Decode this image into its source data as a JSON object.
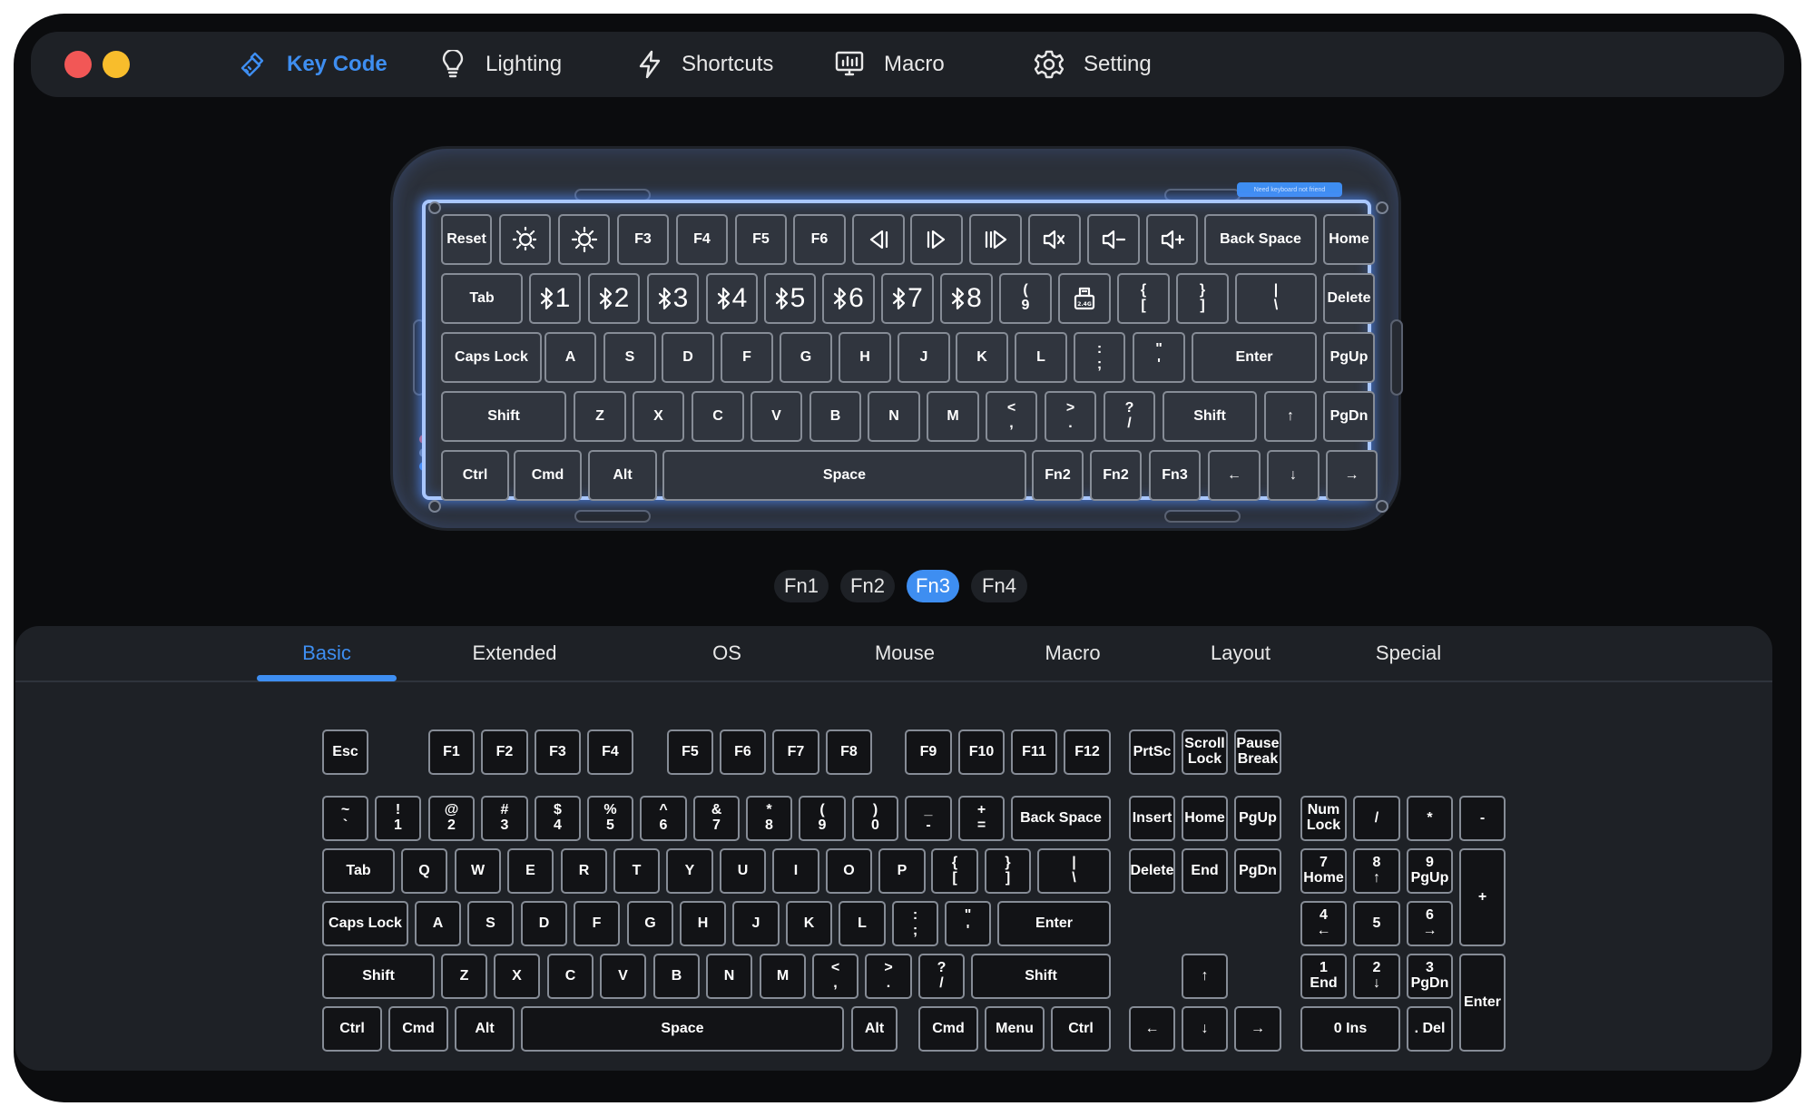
{
  "window": {
    "controls": [
      "close",
      "minimize"
    ]
  },
  "nav": [
    {
      "label": "Key Code",
      "icon": "pen-ruler-icon",
      "active": true
    },
    {
      "label": "Lighting",
      "icon": "lightbulb-icon",
      "active": false
    },
    {
      "label": "Shortcuts",
      "icon": "lightning-icon",
      "active": false
    },
    {
      "label": "Macro",
      "icon": "monitor-icon",
      "active": false
    },
    {
      "label": "Setting",
      "icon": "gear-icon",
      "active": false
    }
  ],
  "device": {
    "badge": "Need keyboard not friend",
    "rows": [
      [
        {
          "label": "Reset"
        },
        {
          "icon": "brightness-down"
        },
        {
          "icon": "brightness-up"
        },
        {
          "label": "F3"
        },
        {
          "label": "F4"
        },
        {
          "label": "F5"
        },
        {
          "label": "F6"
        },
        {
          "icon": "media-prev"
        },
        {
          "icon": "media-next"
        },
        {
          "icon": "media-play"
        },
        {
          "icon": "volume-mute"
        },
        {
          "icon": "volume-down"
        },
        {
          "icon": "volume-up"
        },
        {
          "label": "Back Space"
        },
        {
          "label": "Home"
        }
      ],
      [
        {
          "label": "Tab"
        },
        {
          "bt": "1"
        },
        {
          "bt": "2"
        },
        {
          "bt": "3"
        },
        {
          "bt": "4"
        },
        {
          "bt": "5"
        },
        {
          "bt": "6"
        },
        {
          "bt": "7"
        },
        {
          "bt": "8"
        },
        {
          "top": "(",
          "bottom": "9"
        },
        {
          "icon": "dongle-2.4g"
        },
        {
          "top": "{",
          "bottom": "["
        },
        {
          "top": "}",
          "bottom": "]"
        },
        {
          "top": "|",
          "bottom": "\\"
        },
        {
          "label": "Delete"
        }
      ],
      [
        {
          "label": "Caps Lock"
        },
        {
          "label": "A"
        },
        {
          "label": "S"
        },
        {
          "label": "D"
        },
        {
          "label": "F"
        },
        {
          "label": "G"
        },
        {
          "label": "H"
        },
        {
          "label": "J"
        },
        {
          "label": "K"
        },
        {
          "label": "L"
        },
        {
          "top": ":",
          "bottom": ";"
        },
        {
          "top": "\"",
          "bottom": "'"
        },
        {
          "label": "Enter"
        },
        {
          "label": "PgUp"
        }
      ],
      [
        {
          "label": "Shift"
        },
        {
          "label": "Z"
        },
        {
          "label": "X"
        },
        {
          "label": "C"
        },
        {
          "label": "V"
        },
        {
          "label": "B"
        },
        {
          "label": "N"
        },
        {
          "label": "M"
        },
        {
          "top": "<",
          "bottom": ","
        },
        {
          "top": ">",
          "bottom": "."
        },
        {
          "top": "?",
          "bottom": "/"
        },
        {
          "label": "Shift"
        },
        {
          "label": "↑"
        },
        {
          "label": "PgDn"
        }
      ],
      [
        {
          "label": "Ctrl"
        },
        {
          "label": "Cmd"
        },
        {
          "label": "Alt"
        },
        {
          "label": "Space"
        },
        {
          "label": "Fn2"
        },
        {
          "label": "Fn2"
        },
        {
          "label": "Fn3"
        },
        {
          "label": "←"
        },
        {
          "label": "↓"
        },
        {
          "label": "→"
        }
      ]
    ]
  },
  "fn_layers": [
    {
      "label": "Fn1",
      "active": false
    },
    {
      "label": "Fn2",
      "active": false
    },
    {
      "label": "Fn3",
      "active": true
    },
    {
      "label": "Fn4",
      "active": false
    }
  ],
  "tabs": [
    {
      "label": "Basic",
      "active": true
    },
    {
      "label": "Extended",
      "active": false
    },
    {
      "label": "OS",
      "active": false
    },
    {
      "label": "Mouse",
      "active": false
    },
    {
      "label": "Macro",
      "active": false
    },
    {
      "label": "Layout",
      "active": false
    },
    {
      "label": "Special",
      "active": false
    }
  ],
  "palette": {
    "fn_row": [
      "Esc",
      "F1",
      "F2",
      "F3",
      "F4",
      "F5",
      "F6",
      "F7",
      "F8",
      "F9",
      "F10",
      "F11",
      "F12"
    ],
    "system": [
      [
        "PrtSc"
      ],
      [
        "Scroll",
        "Lock"
      ],
      [
        "Pause",
        "Break"
      ]
    ],
    "number_row": [
      [
        "~",
        "`"
      ],
      [
        "!",
        "1"
      ],
      [
        "@",
        "2"
      ],
      [
        "#",
        "3"
      ],
      [
        "$",
        "4"
      ],
      [
        "%",
        "5"
      ],
      [
        "^",
        "6"
      ],
      [
        "&",
        "7"
      ],
      [
        "*",
        "8"
      ],
      [
        "(",
        "9"
      ],
      [
        ")",
        "0"
      ],
      [
        "_",
        "-"
      ],
      [
        "+",
        "="
      ],
      [
        "Back Space"
      ]
    ],
    "top_row": [
      [
        "Tab"
      ],
      [
        "Q"
      ],
      [
        "W"
      ],
      [
        "E"
      ],
      [
        "R"
      ],
      [
        "T"
      ],
      [
        "Y"
      ],
      [
        "U"
      ],
      [
        "I"
      ],
      [
        "O"
      ],
      [
        "P"
      ],
      [
        "{",
        "["
      ],
      [
        "}",
        "]"
      ],
      [
        "|",
        "\\"
      ]
    ],
    "home_row": [
      [
        "Caps Lock"
      ],
      [
        "A"
      ],
      [
        "S"
      ],
      [
        "D"
      ],
      [
        "F"
      ],
      [
        "G"
      ],
      [
        "H"
      ],
      [
        "J"
      ],
      [
        "K"
      ],
      [
        "L"
      ],
      [
        ":",
        ";"
      ],
      [
        "\"",
        "'"
      ],
      [
        "Enter"
      ]
    ],
    "bottom_row": [
      [
        "Shift"
      ],
      [
        "Z"
      ],
      [
        "X"
      ],
      [
        "C"
      ],
      [
        "V"
      ],
      [
        "B"
      ],
      [
        "N"
      ],
      [
        "M"
      ],
      [
        "<",
        ","
      ],
      [
        ">",
        "."
      ],
      [
        "?",
        "/"
      ],
      [
        "Shift"
      ]
    ],
    "space_row": [
      [
        "Ctrl"
      ],
      [
        "Cmd"
      ],
      [
        "Alt"
      ],
      [
        "Space"
      ],
      [
        "Alt"
      ],
      [
        "Cmd"
      ],
      [
        "Menu"
      ],
      [
        "Ctrl"
      ]
    ],
    "nav_cluster": [
      [
        "Insert"
      ],
      [
        "Home"
      ],
      [
        "PgUp"
      ],
      [
        "Delete"
      ],
      [
        "End"
      ],
      [
        "PgDn"
      ]
    ],
    "arrows": [
      [
        "↑"
      ],
      [
        "←"
      ],
      [
        "↓"
      ],
      [
        "→"
      ]
    ],
    "numpad": [
      [
        "Num",
        "Lock"
      ],
      [
        "/"
      ],
      [
        "*"
      ],
      [
        "-"
      ],
      [
        "7",
        "Home"
      ],
      [
        "8",
        "↑"
      ],
      [
        "9",
        "PgUp"
      ],
      [
        "+"
      ],
      [
        "4",
        "←"
      ],
      [
        "5"
      ],
      [
        "6",
        "→"
      ],
      [
        "1",
        "End"
      ],
      [
        "2",
        "↓"
      ],
      [
        "3",
        "PgDn"
      ],
      [
        "Enter"
      ],
      [
        "0 Ins"
      ],
      [
        ". Del"
      ]
    ]
  }
}
